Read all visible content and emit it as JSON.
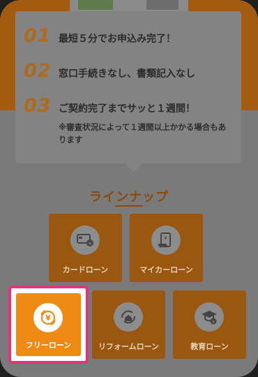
{
  "steps": [
    {
      "num": "01",
      "text": "最短５分でお申込み完了！"
    },
    {
      "num": "02",
      "text": "窓口手続きなし、書類記入なし"
    },
    {
      "num": "03",
      "text": "ご契約完了までサッと１週間！"
    }
  ],
  "note": "※審査状況によって１週間以上かかる場合もあります",
  "lineup": {
    "title": "ラインナップ",
    "items": [
      {
        "label": "カードローン",
        "icon": "credit-card-icon"
      },
      {
        "label": "マイカーローン",
        "icon": "car-loan-icon"
      },
      {
        "label": "フリーローン",
        "icon": "free-loan-yen-icon",
        "selected": true
      },
      {
        "label": "リフォームローン",
        "icon": "house-renovation-icon"
      },
      {
        "label": "教育ローン",
        "icon": "graduation-cap-icon"
      }
    ]
  },
  "colors": {
    "accent": "#ef8a12",
    "highlight_border": "#e4357a",
    "step_number": "#b06a1b"
  }
}
